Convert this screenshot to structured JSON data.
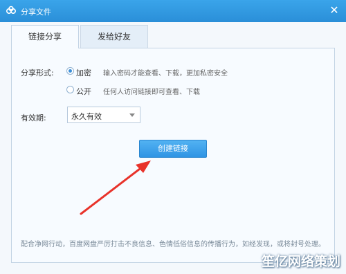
{
  "window": {
    "title": "分享文件",
    "close_icon": "close-icon"
  },
  "tabs": [
    {
      "label": "链接分享",
      "active": true
    },
    {
      "label": "发给好友",
      "active": false
    }
  ],
  "share_form": {
    "label": "分享形式:",
    "options": [
      {
        "label": "加密",
        "description": "输入密码才能查看、下载，更加私密安全",
        "checked": true
      },
      {
        "label": "公开",
        "description": "任何人访问链接即可查看、下载",
        "checked": false
      }
    ]
  },
  "validity": {
    "label": "有效期:",
    "value": "永久有效"
  },
  "create_button": "创建链接",
  "footer_notice": "配合净网行动，百度网盘严厉打击不良信息、色情低俗信息的传播行为，如经发现，或将封号处理。",
  "watermark": "笙亿网络策划",
  "colors": {
    "accent": "#2f94e4",
    "titlebar": "#2a8fd8",
    "arrow": "#e8322a"
  }
}
